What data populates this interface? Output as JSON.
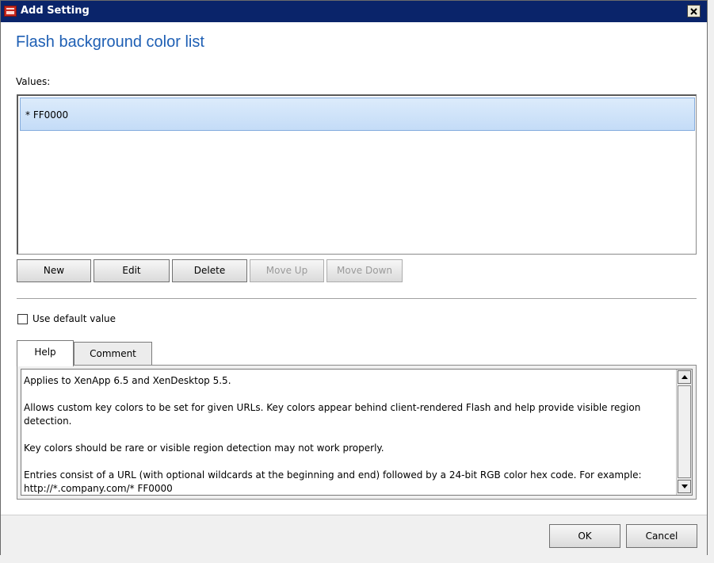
{
  "window": {
    "title": "Add Setting"
  },
  "heading": "Flash background color list",
  "values_label": "Values:",
  "values_list": [
    {
      "text": "* FF0000",
      "selected": true
    }
  ],
  "list_buttons": {
    "new": "New",
    "edit": "Edit",
    "delete": "Delete",
    "move_up": "Move Up",
    "move_down": "Move Down"
  },
  "use_default": {
    "label": "Use default value",
    "checked": false
  },
  "tabs": [
    {
      "label": "Help",
      "active": true
    },
    {
      "label": "Comment",
      "active": false
    }
  ],
  "help_paragraphs": [
    "Applies to XenApp 6.5 and XenDesktop 5.5.",
    "Allows custom key colors to be set for given URLs. Key colors appear behind client-rendered Flash and help provide visible region detection.",
    "Key colors should be rare or visible region detection may not work properly.",
    "Entries consist of a URL (with optional wildcards at the beginning and end) followed by a 24-bit RGB color hex code. For example: http://*.company.com/* FF0000"
  ],
  "footer": {
    "ok": "OK",
    "cancel": "Cancel"
  },
  "colors": {
    "titlebar": "#0a246a",
    "heading": "#1e5fb4",
    "selection": "#c4dcf7"
  },
  "icons": {
    "app": "app-icon",
    "close": "close-icon",
    "scroll_up": "scroll-up-icon",
    "scroll_down": "scroll-down-icon"
  }
}
